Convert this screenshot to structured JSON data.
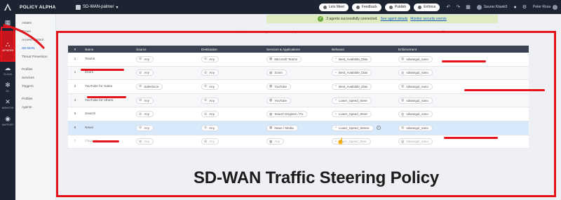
{
  "topbar": {
    "brand": "POLICY ALPHA",
    "project": "SD-WAN-palmer",
    "buttons": [
      {
        "label": "Lets Meet"
      },
      {
        "label": "Feedback"
      },
      {
        "label": "Publish"
      },
      {
        "label": "Enforce"
      }
    ],
    "user1": "Saurav Ktawk9",
    "user2": "Peter Rosa"
  },
  "rail": [
    {
      "label": "",
      "icon": "grid-icon"
    },
    {
      "label": "NETWORK",
      "icon": "network-icon",
      "active": true
    },
    {
      "label": "CLOUD",
      "icon": "cloud-icon"
    },
    {
      "label": "DC",
      "icon": "snowflake-icon"
    },
    {
      "label": "MONITOR",
      "icon": "monitor-icon"
    },
    {
      "label": "SUPPORT",
      "icon": "support-icon"
    }
  ],
  "subnav": {
    "items": [
      {
        "label": "Assets"
      },
      {
        "label": "Zones"
      },
      {
        "label": "Access Control"
      },
      {
        "label": "SD-WAN",
        "active": true
      },
      {
        "label": "Threat Prevention"
      },
      {
        "label": "Profiles",
        "gap": true
      },
      {
        "label": "Services"
      },
      {
        "label": "Triggers"
      },
      {
        "label": "Profiles",
        "gap": true
      },
      {
        "label": "Agents"
      }
    ]
  },
  "notification": {
    "text": "2 agents successfully connected.",
    "link1": "See agent details",
    "link2": "Monitor security events"
  },
  "toolbar": {
    "items": [
      "+ Add",
      "Import",
      "Export"
    ]
  },
  "table": {
    "columns": [
      "#",
      "Name",
      "Source",
      "Destination",
      "Services & Applications",
      "Behavior",
      "Enforcement"
    ],
    "rows": [
      {
        "num": "1",
        "name": "Teams",
        "source": "Any",
        "destination": "Any",
        "service": "Microsoft Teams",
        "behavior": "Best_Available_Dlas",
        "enforcement": "sdwangul_nano"
      },
      {
        "num": "1",
        "name": "Zoom",
        "source": "Any",
        "destination": "Any",
        "service": "Zoom",
        "behavior": "Best_Available_Dlas",
        "enforcement": "sdwangul_nano"
      },
      {
        "num": "2",
        "name": "YouTube for Sales",
        "source": "Salesforce",
        "destination": "Any",
        "service": "YouTube",
        "behavior": "Best_Available_Dlas",
        "enforcement": "sdwangul_nano"
      },
      {
        "num": "4",
        "name": "YouTube for others",
        "source": "Any",
        "destination": "Any",
        "service": "YouTube",
        "behavior": "Lower_Speed_Steer",
        "enforcement": "sdwangul_nano"
      },
      {
        "num": "5",
        "name": "Search",
        "source": "Any",
        "destination": "Any",
        "service": "Search Engines / Po",
        "behavior": "Lower_Speed_Steer",
        "enforcement": "sdwangul_nano"
      },
      {
        "num": "6",
        "name": "News",
        "source": "Any",
        "destination": "Any",
        "service": "News / Media",
        "behavior": "Lower_Speed_Steere",
        "enforcement": "sdwangul_nano",
        "selected": true
      },
      {
        "num": "7",
        "name": "Cleanup",
        "source": "Any",
        "destination": "Any",
        "service": "Any",
        "behavior": "Lower_Speed_Stee",
        "enforcement": "sdwangul_nano",
        "disabled": true
      }
    ]
  },
  "caption": "SD-WAN Traffic Steering Policy",
  "colors": {
    "accent_red": "#e3141c",
    "nav_dark": "#1c2331",
    "selected_row": "#d7e9fb",
    "notify_bg": "#dfecc1"
  }
}
